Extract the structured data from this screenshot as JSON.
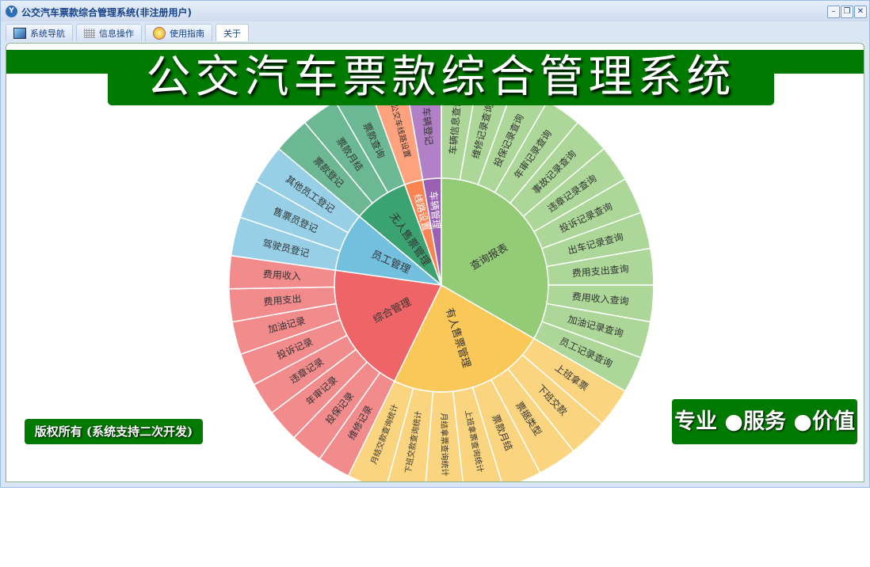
{
  "window": {
    "title": "公交汽车票款综合管理系统(非注册用户)",
    "minimize": "–",
    "restore": "❐",
    "close": "✕"
  },
  "tabs": [
    {
      "label": "系统导航",
      "icon": "monitor-icon"
    },
    {
      "label": "信息操作",
      "icon": "grid-icon"
    },
    {
      "label": "使用指南",
      "icon": "help-icon"
    },
    {
      "label": "关于",
      "icon": ""
    }
  ],
  "banner": {
    "title": "公交汽车票款综合管理系统"
  },
  "footer": {
    "copyright": "版权所有 (系统支持二次开发)",
    "slogan": "专业 ●服务 ●价值"
  },
  "chart_data": {
    "type": "sunburst",
    "groups": [
      {
        "name": "查询报表",
        "color": "#93cb77",
        "leafColor": "#acd798",
        "leafValue": 10,
        "children": [
          "车辆信息查询",
          "维修记录查询",
          "投保记录查询",
          "年审记录查询",
          "事故记录查询",
          "违章记录查询",
          "投诉记录查询",
          "出车记录查询",
          "费用支出查询",
          "费用收入查询",
          "加油记录查询",
          "员工记录查询"
        ]
      },
      {
        "name": "有人售票管理",
        "color": "#f9c858",
        "leafColor": "#fbd47f",
        "leafValue": 10.75,
        "children": [
          "上班拿票",
          "下班交款",
          "票据类型",
          "票款月结",
          "上班拿票查询统计",
          "月结拿票查询统计",
          "下班交款查询统计",
          "月结交款查询统计"
        ]
      },
      {
        "name": "综合管理",
        "color": "#ef6567",
        "leafColor": "#f28b8c",
        "leafValue": 9,
        "children": [
          "维修记录",
          "投保记录",
          "年审记录",
          "违章记录",
          "投诉记录",
          "加油记录",
          "费用支出",
          "费用收入"
        ]
      },
      {
        "name": "员工管理",
        "color": "#73c0de",
        "leafColor": "#96cfe6",
        "leafValue": 10.67,
        "children": [
          "驾驶员登记",
          "售票员登记",
          "其他员工登记"
        ]
      },
      {
        "name": "无人售票管理",
        "color": "#3ba272",
        "leafColor": "#6cb894",
        "leafValue": 10,
        "children": [
          "票款登记",
          "票款月结",
          "票款查询"
        ]
      },
      {
        "name": "线路设置",
        "color": "#fc8452",
        "leafColor": "#fda27c",
        "leafValue": 10,
        "children": [
          "公交车线路设置"
        ]
      },
      {
        "name": "车辆管理",
        "color": "#9a60b4",
        "leafColor": "#b280c7",
        "leafValue": 10,
        "children": [
          "车辆登记"
        ]
      }
    ]
  }
}
